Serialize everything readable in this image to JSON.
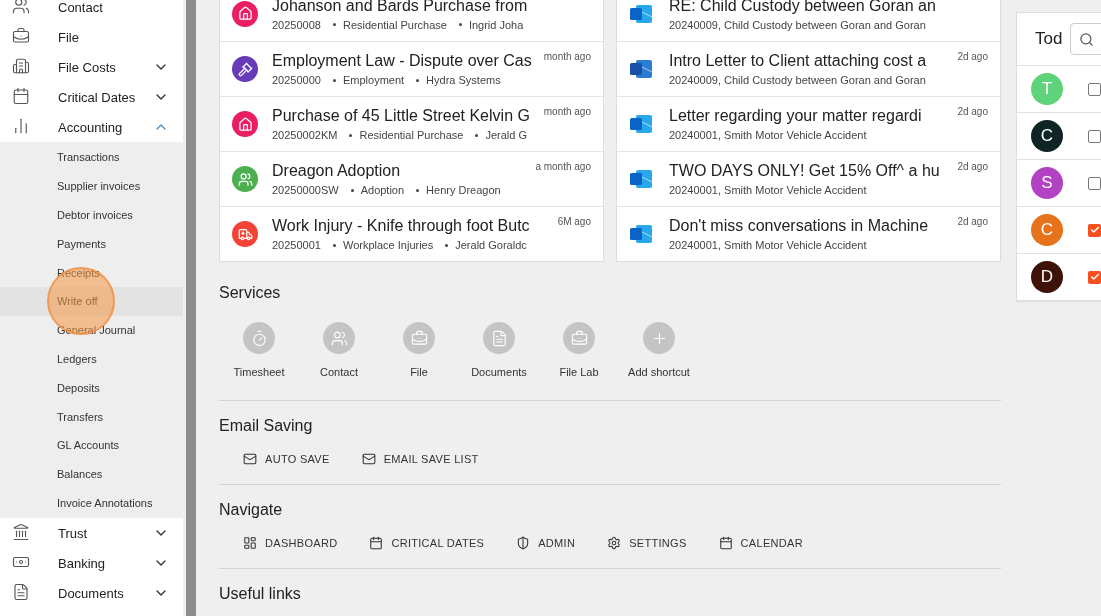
{
  "sidebar": {
    "items": [
      {
        "label": "Contact",
        "kind": "link"
      },
      {
        "label": "File",
        "kind": "link"
      },
      {
        "label": "File Costs",
        "kind": "group",
        "expanded": false
      },
      {
        "label": "Critical Dates",
        "kind": "group",
        "expanded": false
      },
      {
        "label": "Accounting",
        "kind": "group",
        "expanded": true,
        "children": [
          {
            "label": "Transactions",
            "selected": false
          },
          {
            "label": "Supplier invoices",
            "selected": false
          },
          {
            "label": "Debtor invoices",
            "selected": false
          },
          {
            "label": "Payments",
            "selected": false
          },
          {
            "label": "Receipts",
            "selected": false
          },
          {
            "label": "Write off",
            "selected": true
          },
          {
            "label": "General Journal",
            "selected": false
          },
          {
            "label": "Ledgers",
            "selected": false
          },
          {
            "label": "Deposits",
            "selected": false
          },
          {
            "label": "Transfers",
            "selected": false
          },
          {
            "label": "GL Accounts",
            "selected": false
          },
          {
            "label": "Balances",
            "selected": false
          },
          {
            "label": "Invoice Annotations",
            "selected": false
          }
        ]
      },
      {
        "label": "Trust",
        "kind": "group",
        "expanded": false
      },
      {
        "label": "Banking",
        "kind": "group",
        "expanded": false
      },
      {
        "label": "Documents",
        "kind": "group",
        "expanded": false
      }
    ]
  },
  "matters": [
    {
      "kind": "residential",
      "color": "#e91e63",
      "title": "Johanson and Bards Purchase from",
      "parts": [
        "20250008",
        "Residential Purchase",
        "Ingrid Joha"
      ]
    },
    {
      "kind": "employment",
      "color": "#673ab7",
      "title": "Employment Law - Dispute over Cas",
      "time": "month ago",
      "parts": [
        "20250000",
        "Employment",
        "Hydra Systems"
      ]
    },
    {
      "kind": "residential",
      "color": "#e91e63",
      "title": "Purchase of 45 Little Street Kelvin G",
      "time": "month ago",
      "parts": [
        "20250002KM",
        "Residential Purchase",
        "Jerald G"
      ]
    },
    {
      "kind": "adoption",
      "color": "#4caf50",
      "title": "Dreagon Adoption",
      "time": "a month ago",
      "parts": [
        "20250000SW",
        "Adoption",
        "Henry Dreagon"
      ]
    },
    {
      "kind": "injury",
      "color": "#f44336",
      "title": "Work Injury - Knife through foot Butc",
      "time": "6M ago",
      "parts": [
        "20250001",
        "Workplace Injuries",
        "Jerald Goraldc"
      ]
    }
  ],
  "documents": [
    {
      "kind": "outlook",
      "title": "RE: Child Custody between Goran an",
      "subtitle": "20240009, Child Custody between Goran and Goran"
    },
    {
      "kind": "word",
      "title": "Intro Letter to Client attaching cost a",
      "time": "2d ago",
      "subtitle": "20240009, Child Custody between Goran and Goran"
    },
    {
      "kind": "outlook",
      "title": "Letter regarding your matter regardi",
      "time": "2d ago",
      "subtitle": "20240001, Smith Motor Vehicle Accident"
    },
    {
      "kind": "outlook",
      "title": "TWO DAYS ONLY! Get 15% Off^ a hu",
      "time": "2d ago",
      "subtitle": "20240001, Smith Motor Vehicle Accident"
    },
    {
      "kind": "outlook",
      "title": "Don't miss conversations in Machine",
      "time": "2d ago",
      "subtitle": "20240001, Smith Motor Vehicle Accident"
    }
  ],
  "services": {
    "title": "Services",
    "shortcuts": [
      {
        "kind": "timer",
        "label": "Timesheet"
      },
      {
        "kind": "users",
        "label": "Contact"
      },
      {
        "kind": "briefcase",
        "label": "File"
      },
      {
        "kind": "document",
        "label": "Documents"
      },
      {
        "kind": "briefcase",
        "label": "File Lab"
      },
      {
        "kind": "add",
        "label": "Add shortcut"
      }
    ]
  },
  "email_saving": {
    "title": "Email Saving",
    "buttons": [
      {
        "kind": "mail",
        "label": "AUTO SAVE"
      },
      {
        "kind": "mail",
        "label": "EMAIL SAVE LIST"
      }
    ]
  },
  "navigate": {
    "title": "Navigate",
    "buttons": [
      {
        "kind": "dashboard",
        "label": "DASHBOARD"
      },
      {
        "kind": "calendar",
        "label": "CRITICAL DATES"
      },
      {
        "kind": "shield",
        "label": "ADMIN"
      },
      {
        "kind": "gear",
        "label": "SETTINGS"
      },
      {
        "kind": "calendar",
        "label": "CALENDAR"
      }
    ]
  },
  "useful_links": {
    "title": "Useful links"
  },
  "todo": {
    "title": "Tod",
    "rows": [
      {
        "initial": "T",
        "color": "#5fd37a",
        "checked": false
      },
      {
        "initial": "C",
        "color": "#0f2424",
        "checked": false
      },
      {
        "initial": "S",
        "color": "#b341c4",
        "checked": false
      },
      {
        "initial": "C",
        "color": "#e6731c",
        "checked": true
      },
      {
        "initial": "D",
        "color": "#3f1208",
        "checked": true
      }
    ]
  }
}
